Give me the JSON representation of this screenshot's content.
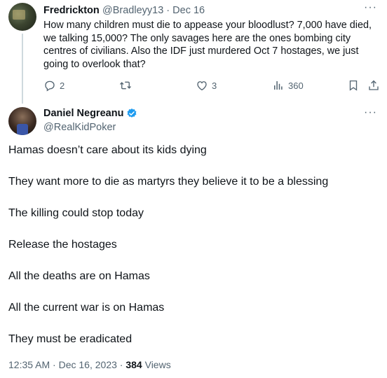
{
  "reply_tweet": {
    "display_name": "Fredrickton",
    "handle": "@Bradleyy13",
    "separator": "·",
    "date": "Dec 16",
    "text": "How many children must die to appease your bloodlust? 7,000 have died, we talking 15,000? The only savages here are the ones bombing city centres of civilians. Also the IDF just murdered Oct 7 hostages, we just going to overlook that?",
    "more_label": "···",
    "replies": "2",
    "retweets": "",
    "likes": "3",
    "views": "360",
    "icons": [
      "reply-icon",
      "retweet-icon",
      "like-icon",
      "views-icon",
      "bookmark-icon",
      "share-icon"
    ]
  },
  "main_tweet": {
    "display_name": "Daniel Negreanu",
    "handle": "@RealKidPoker",
    "more_label": "···",
    "verified_color": "#1d9bf0",
    "lines": [
      "Hamas doesn’t care about its kids dying",
      "They want more to die as martyrs they believe it to be a blessing",
      "The killing could stop today",
      "Release the hostages",
      "All the deaths are on Hamas",
      "All the current war is on Hamas",
      "They must be eradicated"
    ],
    "time": "12:35 AM",
    "date": "Dec 16, 2023",
    "separator": "·",
    "views_count": "384",
    "views_label": "Views"
  }
}
